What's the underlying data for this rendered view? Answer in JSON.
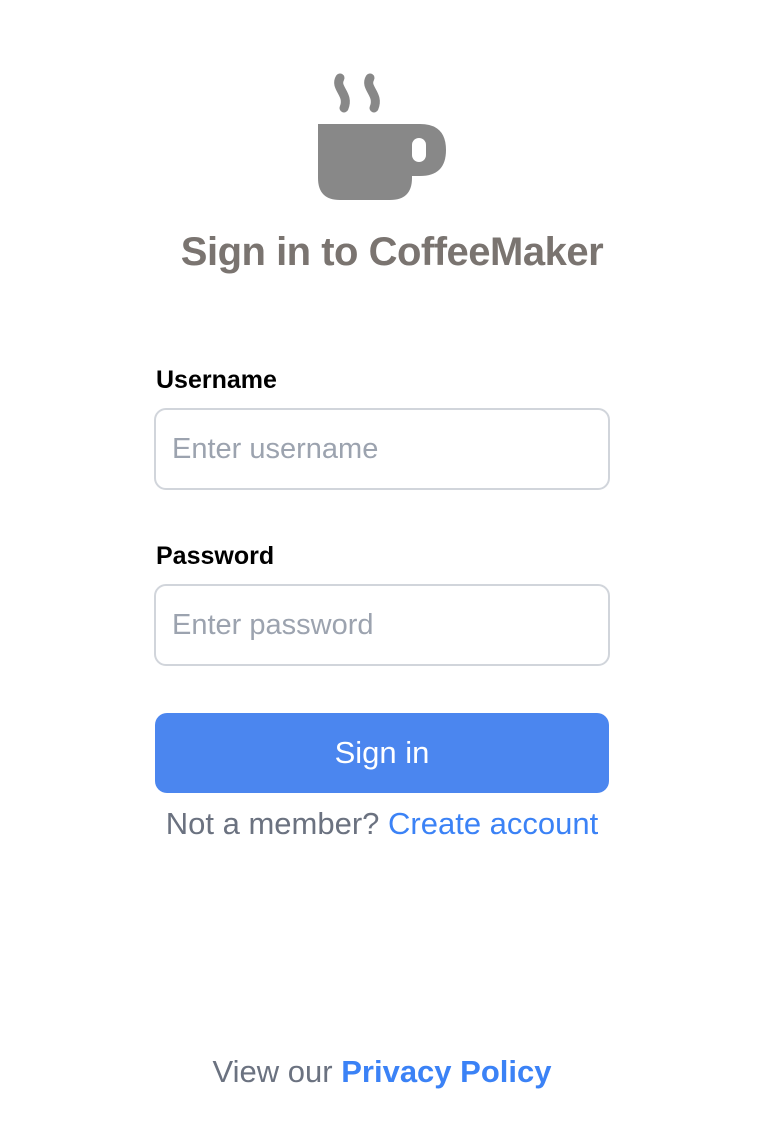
{
  "app": {
    "title": "Sign in to CoffeeMaker",
    "logo_icon": "coffee-cup-icon"
  },
  "form": {
    "username_label": "Username",
    "username_placeholder": "Enter username",
    "username_value": "",
    "password_label": "Password",
    "password_placeholder": "Enter password",
    "password_value": "",
    "submit_label": "Sign in"
  },
  "signup": {
    "prompt": "Not a member?",
    "link_label": "Create account"
  },
  "footer": {
    "prefix": "View our",
    "privacy_link_label": "Privacy Policy"
  },
  "colors": {
    "accent": "#4b86ef",
    "link": "#3b82f6",
    "title": "#7a7470",
    "icon": "#888888",
    "muted_text": "#6b7280",
    "input_border": "#d1d5db"
  }
}
